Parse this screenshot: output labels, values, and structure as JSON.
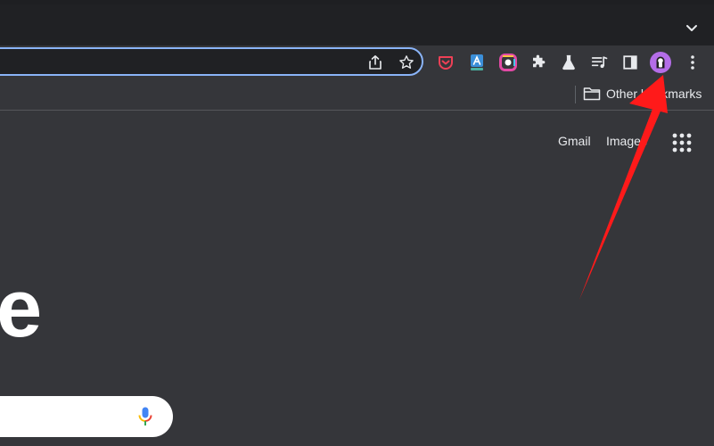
{
  "bookmarks_bar": {
    "other_bookmarks_label": "Other bookmarks"
  },
  "ntp": {
    "gmail_label": "Gmail",
    "images_label": "Images",
    "logo_partial": "e"
  },
  "toolbar": {
    "icons": [
      "share-icon",
      "star-icon",
      "pocket-icon",
      "translate-extension-icon",
      "color-picker-extension-icon",
      "puzzle-icon",
      "flask-icon",
      "media-queue-icon",
      "side-panel-icon",
      "profile-avatar",
      "more-menu-icon"
    ]
  },
  "colors": {
    "accent": "#8ab4f8",
    "annotation_arrow": "#ff1a1a",
    "profile_avatar": "#b46de8",
    "pocket": "#ef4056"
  }
}
